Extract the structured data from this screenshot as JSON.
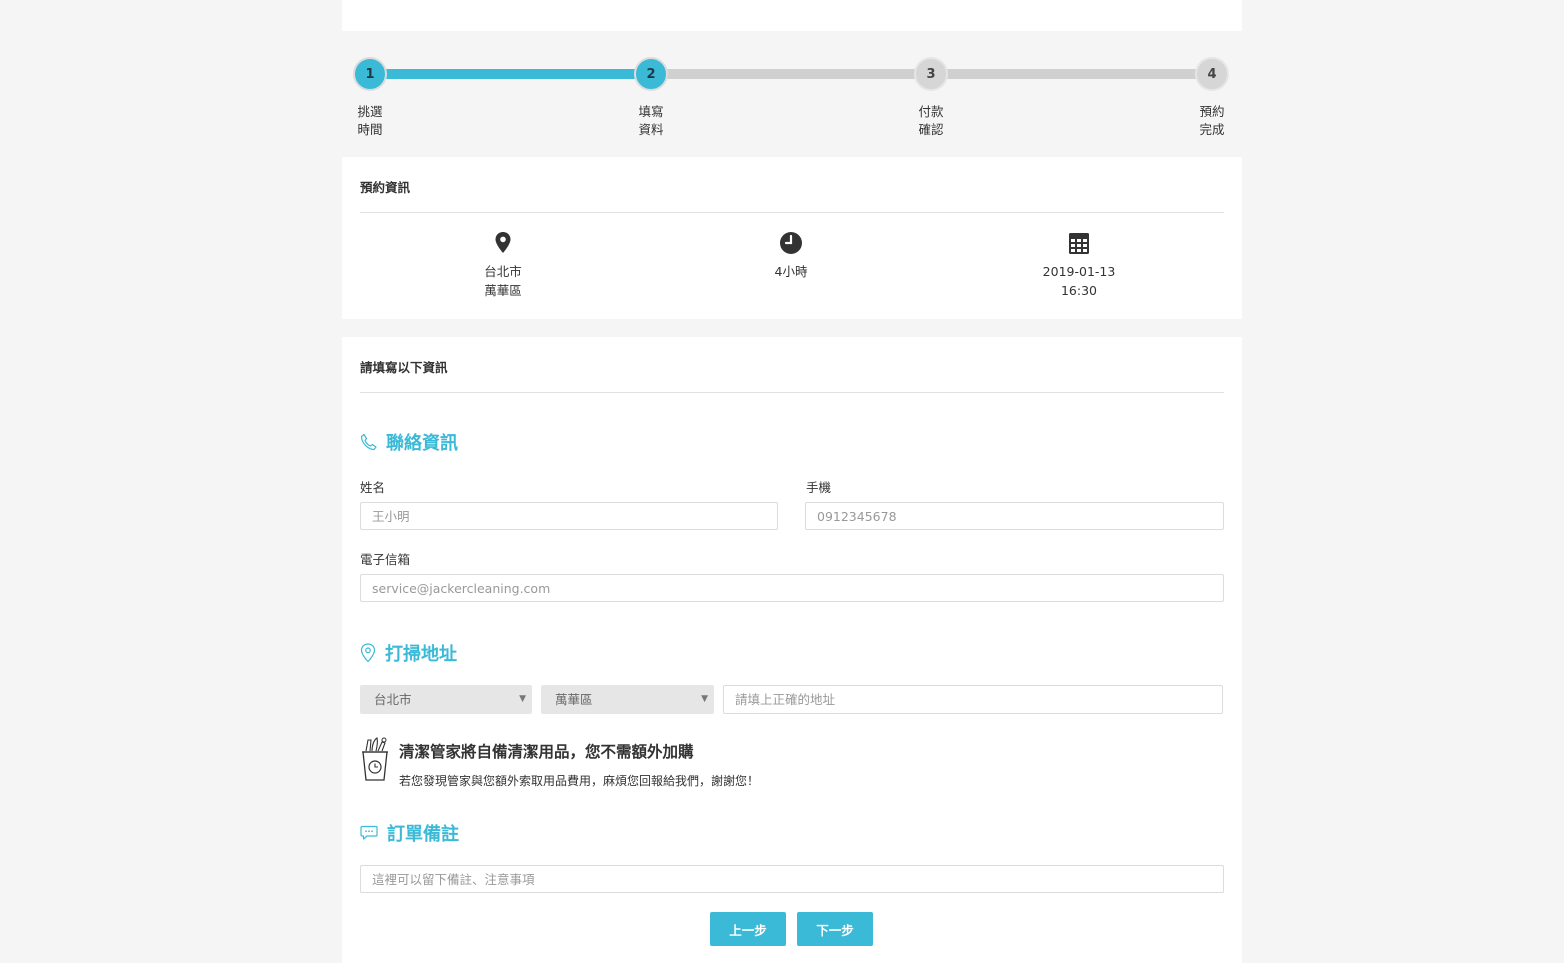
{
  "stepper": {
    "progress": 0.333,
    "steps": [
      {
        "number": "1",
        "line1": "挑選",
        "line2": "時間",
        "state": "active"
      },
      {
        "number": "2",
        "line1": "填寫",
        "line2": "資料",
        "state": "active"
      },
      {
        "number": "3",
        "line1": "付款",
        "line2": "確認",
        "state": "inactive"
      },
      {
        "number": "4",
        "line1": "預約",
        "line2": "完成",
        "state": "inactive"
      }
    ]
  },
  "booking_info": {
    "title": "預約資訊",
    "location_line1": "台北市",
    "location_line2": "萬華區",
    "duration": "4小時",
    "date": "2019-01-13",
    "time": "16:30",
    "icons": [
      "map-pin-icon",
      "clock-icon",
      "calendar-icon"
    ]
  },
  "form": {
    "title": "請填寫以下資訊",
    "contact": {
      "heading": "聯絡資訊",
      "name_label": "姓名",
      "name_placeholder": "王小明",
      "phone_label": "手機",
      "phone_placeholder": "0912345678",
      "email_label": "電子信箱",
      "email_placeholder": "service@jackercleaning.com"
    },
    "address": {
      "heading": "打掃地址",
      "city": "台北市",
      "district": "萬華區",
      "street_placeholder": "請填上正確的地址"
    },
    "notice": {
      "title": "清潔管家將自備清潔用品，您不需額外加購",
      "subtitle": "若您發現管家與您額外索取用品費用，麻煩您回報給我們，謝謝您！"
    },
    "remarks": {
      "heading": "訂單備註",
      "placeholder": "這裡可以留下備註、注意事項"
    },
    "buttons": {
      "prev": "上一步",
      "next": "下一步"
    }
  },
  "colors": {
    "accent": "#3bbad8",
    "track_inactive": "#d0d0d0",
    "background": "#f5f5f5"
  }
}
